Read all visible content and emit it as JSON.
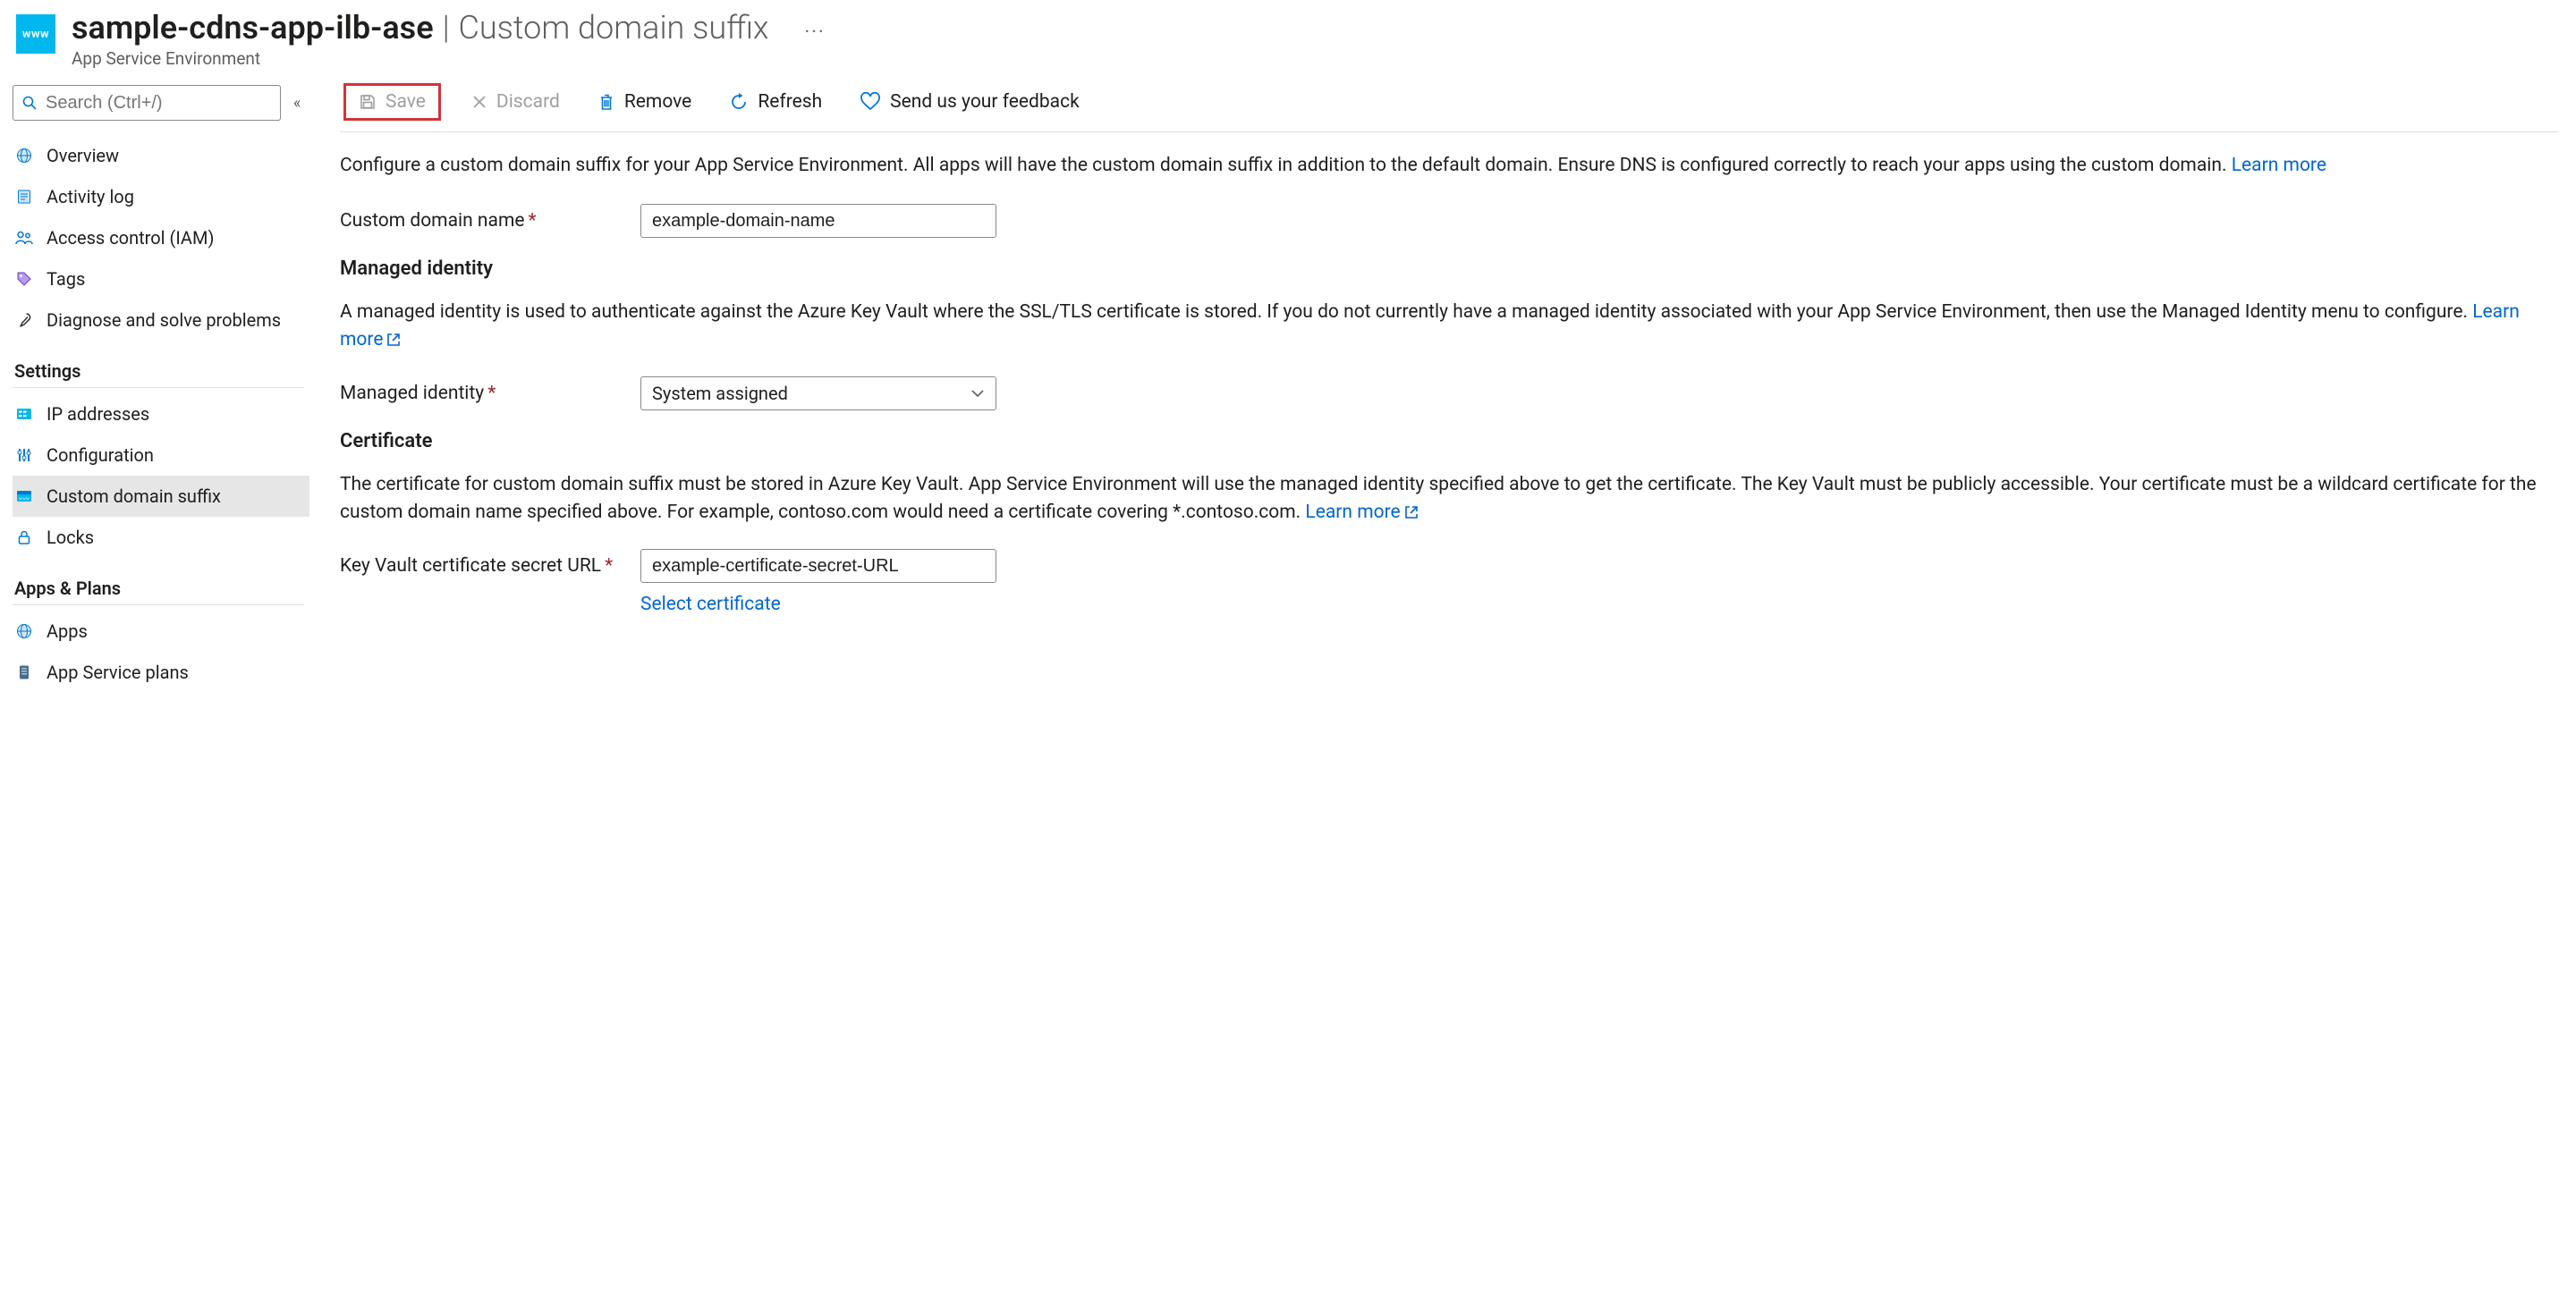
{
  "header": {
    "resource_name": "sample-cdns-app-ilb-ase",
    "separator": "|",
    "blade_title": "Custom domain suffix",
    "resource_type": "App Service Environment",
    "icon_text": "www",
    "more_symbol": "···"
  },
  "sidebar": {
    "search_placeholder": "Search (Ctrl+/)",
    "collapse_glyph": "«",
    "top_items": [
      {
        "id": "overview",
        "label": "Overview"
      },
      {
        "id": "activity-log",
        "label": "Activity log"
      },
      {
        "id": "access-control",
        "label": "Access control (IAM)"
      },
      {
        "id": "tags",
        "label": "Tags"
      },
      {
        "id": "diagnose",
        "label": "Diagnose and solve problems"
      }
    ],
    "groups": [
      {
        "id": "settings",
        "header": "Settings",
        "items": [
          {
            "id": "ip-addresses",
            "label": "IP addresses"
          },
          {
            "id": "configuration",
            "label": "Configuration"
          },
          {
            "id": "custom-domain-suffix",
            "label": "Custom domain suffix",
            "selected": true
          },
          {
            "id": "locks",
            "label": "Locks"
          }
        ]
      },
      {
        "id": "apps-plans",
        "header": "Apps & Plans",
        "items": [
          {
            "id": "apps",
            "label": "Apps"
          },
          {
            "id": "app-service-plans",
            "label": "App Service plans"
          }
        ]
      }
    ]
  },
  "toolbar": {
    "save": "Save",
    "discard": "Discard",
    "remove": "Remove",
    "refresh": "Refresh",
    "feedback": "Send us your feedback"
  },
  "main": {
    "intro_text": "Configure a custom domain suffix for your App Service Environment. All apps will have the custom domain suffix in addition to the default domain. Ensure DNS is configured correctly to reach your apps using the custom domain. ",
    "intro_learn_more": "Learn more",
    "custom_domain_label": "Custom domain name",
    "custom_domain_value": "example-domain-name",
    "managed_identity_heading": "Managed identity",
    "managed_identity_desc": "A managed identity is used to authenticate against the Azure Key Vault where the SSL/TLS certificate is stored. If you do not currently have a managed identity associated with your App Service Environment, then use the Managed Identity menu to configure. ",
    "managed_identity_learn_more": "Learn more",
    "managed_identity_label": "Managed identity",
    "managed_identity_value": "System assigned",
    "certificate_heading": "Certificate",
    "certificate_desc": "The certificate for custom domain suffix must be stored in Azure Key Vault. App Service Environment will use the managed identity specified above to get the certificate. The Key Vault must be publicly accessible. Your certificate must be a wildcard certificate for the custom domain name specified above. For example, contoso.com would need a certificate covering *.contoso.com. ",
    "certificate_learn_more": "Learn more",
    "kv_secret_label": "Key Vault certificate secret URL",
    "kv_secret_value": "example-certificate-secret-URL",
    "select_certificate": "Select certificate"
  },
  "colors": {
    "accent": "#0078d4",
    "link": "#0066cc",
    "highlight_border": "#d13438",
    "required_star": "#a4262c"
  }
}
